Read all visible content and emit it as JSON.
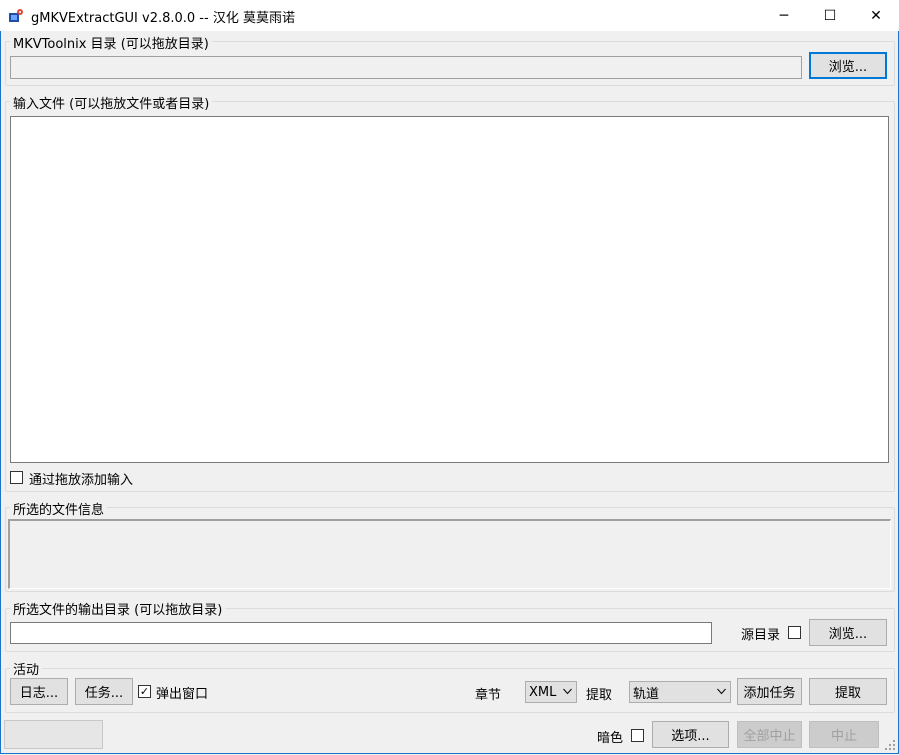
{
  "window": {
    "title": "gMKVExtractGUI v2.8.0.0 -- 汉化 莫莫雨诺",
    "minimize_glyph": "─",
    "maximize_glyph": "☐",
    "close_glyph": "✕"
  },
  "mkvtoolnix": {
    "group_label": "MKVToolnix 目录 (可以拖放目录)",
    "path_value": "",
    "browse_label": "浏览..."
  },
  "input": {
    "group_label": "输入文件 (可以拖放文件或者目录)",
    "append_checkbox_label": "通过拖放添加输入",
    "append_checked": false
  },
  "file_info": {
    "group_label": "所选的文件信息",
    "content": ""
  },
  "output": {
    "group_label": "所选文件的输出目录 (可以拖放目录)",
    "path_value": "",
    "source_dir_label": "源目录",
    "source_dir_checked": false,
    "browse_label": "浏览..."
  },
  "actions": {
    "group_label": "活动",
    "log_label": "日志...",
    "jobs_label": "任务...",
    "popup_label": "弹出窗口",
    "popup_checked": true,
    "chapters_label": "章节",
    "chapters_value": "XML",
    "extract_label": "提取",
    "extract_value": "轨道",
    "add_job_label": "添加任务",
    "extract_button_label": "提取"
  },
  "bottom": {
    "dark_label": "暗色",
    "dark_checked": false,
    "options_label": "选项...",
    "abort_all_label": "全部中止",
    "abort_label": "中止",
    "check_glyph": "✓"
  }
}
